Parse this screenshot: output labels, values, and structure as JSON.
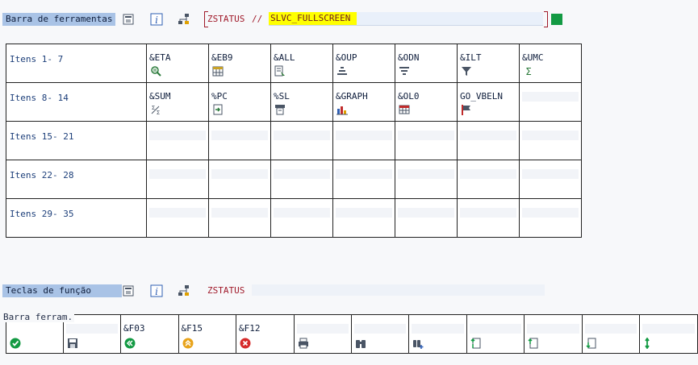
{
  "toolbar_section": {
    "label": "Barra de ferramentas",
    "program": "ZSTATUS",
    "separator": "//",
    "status": "SLVC_FULLSCREEN"
  },
  "toolbar_rows": [
    {
      "label": "Itens  1-  7",
      "cells": [
        {
          "name": "&ETA",
          "icon": "find-icon"
        },
        {
          "name": "&EB9",
          "icon": "spreadsheet-icon"
        },
        {
          "name": "&ALL",
          "icon": "select-all-icon"
        },
        {
          "name": "&OUP",
          "icon": "sort-ascending-icon"
        },
        {
          "name": "&ODN",
          "icon": "sort-descending-icon"
        },
        {
          "name": "&ILT",
          "icon": "filter-icon"
        },
        {
          "name": "&UMC",
          "icon": "sum-icon"
        }
      ]
    },
    {
      "label": "Itens  8- 14",
      "cells": [
        {
          "name": "&SUM",
          "icon": "subtotal-icon"
        },
        {
          "name": "%PC",
          "icon": "export-file-icon"
        },
        {
          "name": "%SL",
          "icon": "print-preview-icon"
        },
        {
          "name": "&GRAPH",
          "icon": "graph-icon"
        },
        {
          "name": "&OL0",
          "icon": "layout-icon"
        },
        {
          "name": "GO_VBELN",
          "icon": "flag-icon"
        },
        {
          "name": "",
          "icon": ""
        }
      ]
    },
    {
      "label": "Itens 15- 21",
      "cells": [
        {},
        {},
        {},
        {},
        {},
        {},
        {}
      ]
    },
    {
      "label": "Itens 22- 28",
      "cells": [
        {},
        {},
        {},
        {},
        {},
        {},
        {}
      ]
    },
    {
      "label": "Itens 29- 35",
      "cells": [
        {},
        {},
        {},
        {},
        {},
        {},
        {}
      ]
    }
  ],
  "function_keys_section": {
    "label": "Teclas de função",
    "program": "ZSTATUS"
  },
  "function_bar": {
    "label": "Barra ferram.",
    "cells": [
      {
        "name": "",
        "icon": "check-icon"
      },
      {
        "name": "",
        "icon": "save-icon"
      },
      {
        "name": "&F03",
        "icon": "back-icon"
      },
      {
        "name": "&F15",
        "icon": "exit-icon"
      },
      {
        "name": "&F12",
        "icon": "cancel-icon"
      },
      {
        "name": "",
        "icon": "print-icon"
      },
      {
        "name": "",
        "icon": "binoculars-icon"
      },
      {
        "name": "",
        "icon": "find-next-icon"
      },
      {
        "name": "",
        "icon": "first-page-icon"
      },
      {
        "name": "",
        "icon": "previous-page-icon"
      },
      {
        "name": "",
        "icon": "next-page-icon"
      },
      {
        "name": "",
        "icon": "last-page-icon"
      }
    ]
  },
  "colors": {
    "label_bg": "#a9c3e6",
    "highlight": "#ffff00",
    "program_red": "#a01a2a",
    "confirm_green": "#139a43"
  }
}
